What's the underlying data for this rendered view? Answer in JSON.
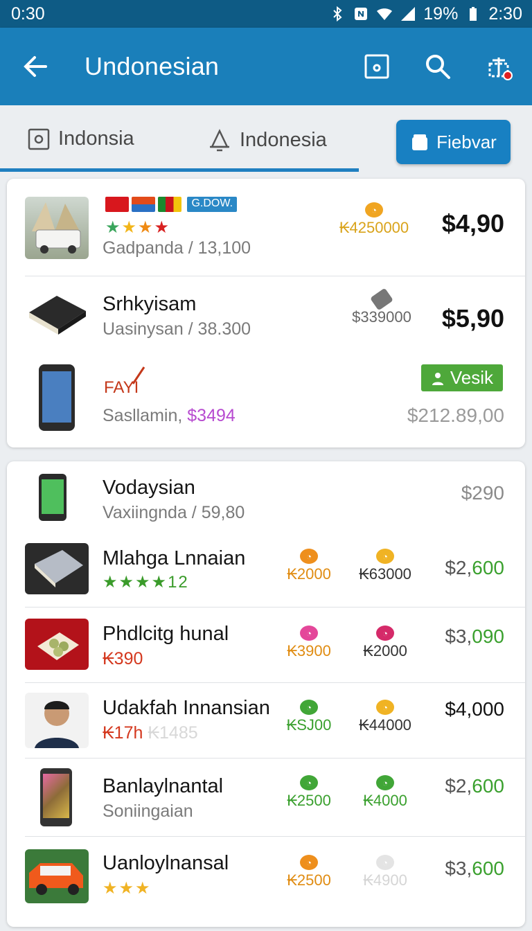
{
  "status_bar": {
    "time_left": "0:30",
    "battery": "19%",
    "time_right": "2:30"
  },
  "app_bar": {
    "title": "Undonesian"
  },
  "tabs": [
    {
      "label": "Indonsia",
      "icon": "square-icon"
    },
    {
      "label": "Indonesia",
      "icon": "bell-icon"
    }
  ],
  "tab_button": {
    "label": "Fiebvar"
  },
  "card1": {
    "row1": {
      "badge": "G.DOW.",
      "sub": "Gadpanda / 13,100",
      "mini": "₭4250000",
      "price": "$4,90"
    },
    "row2": {
      "name": "Srhkyisam",
      "sub": "Uasinysan / 38.300",
      "mini": "$339000",
      "price": "$5,90"
    },
    "row3": {
      "label": "FAYI",
      "sub_a": "Sasllamin,",
      "sub_b": "$3494",
      "button": "Vesik",
      "price": "$212.89,00"
    }
  },
  "card2": {
    "rows": [
      {
        "name": "Vodaysian",
        "sub": "Vaxiingnda / 59,80",
        "price": "$290"
      },
      {
        "name": "Mlahga Lnnaian",
        "stars_text": "12",
        "mini_a": "₭2000",
        "mini_b": "₭63000",
        "price_a": "$2,",
        "price_b": "600"
      },
      {
        "name": "Phdlcitg hunal",
        "sub": "₭390",
        "mini_a": "₭3900",
        "mini_b": "₭2000",
        "price_a": "$3,",
        "price_b": "090"
      },
      {
        "name": "Udakfah Innansian",
        "sub_a": "₭17h",
        "sub_b": "₭1485",
        "mini_a": "₭SJ00",
        "mini_b": "₭44000",
        "price_a": "$4,",
        "price_b": "000"
      },
      {
        "name": "Banlaylnantal",
        "sub": "Soniingaian",
        "mini_a": "₭2500",
        "mini_b": "₭4000",
        "price_a": "$2,",
        "price_b": "600"
      },
      {
        "name": "Uanloylnansal",
        "mini_a": "₭2500",
        "mini_b": "₭4900",
        "price_a": "$3,",
        "price_b": "600"
      }
    ]
  }
}
